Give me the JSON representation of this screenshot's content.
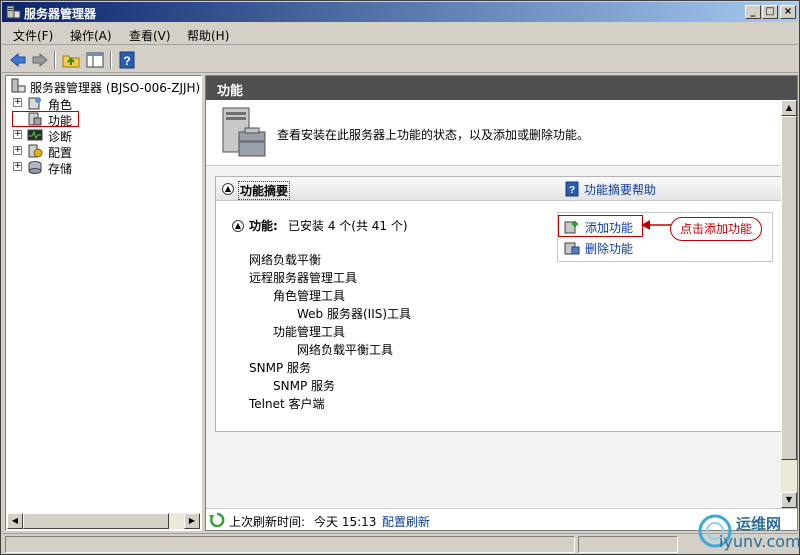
{
  "window": {
    "title": "服务器管理器",
    "minimize_label": "_",
    "restore_label": "□",
    "close_label": "×"
  },
  "menu": {
    "items": [
      {
        "label": "文件(F)"
      },
      {
        "label": "操作(A)"
      },
      {
        "label": "查看(V)"
      },
      {
        "label": "帮助(H)"
      }
    ]
  },
  "toolbar": {
    "icons": [
      "back-arrow-icon",
      "forward-arrow-icon",
      "up-folder-icon",
      "show-hide-tree-icon",
      "help-icon"
    ]
  },
  "tree": {
    "root_label": "服务器管理器 (BJSO-006-ZJJH)",
    "items": [
      {
        "label": "角色",
        "expander": "+",
        "icon": "roles-icon"
      },
      {
        "label": "功能",
        "expander": "",
        "icon": "features-icon",
        "selected": true
      },
      {
        "label": "诊断",
        "expander": "+",
        "icon": "diagnostics-icon"
      },
      {
        "label": "配置",
        "expander": "+",
        "icon": "configuration-icon"
      },
      {
        "label": "存储",
        "expander": "+",
        "icon": "storage-icon"
      }
    ]
  },
  "main": {
    "header": "功能",
    "banner_text": "查看安装在此服务器上功能的状态，以及添加或删除功能。",
    "summary_title": "功能摘要",
    "summary_help_link": "功能摘要帮助",
    "features_heading": "功能:",
    "features_count": "已安装 4 个(共 41 个)",
    "features": [
      {
        "label": "网络负载平衡",
        "level": 0
      },
      {
        "label": "远程服务器管理工具",
        "level": 0
      },
      {
        "label": "角色管理工具",
        "level": 1
      },
      {
        "label": "Web 服务器(IIS)工具",
        "level": 2
      },
      {
        "label": "功能管理工具",
        "level": 1
      },
      {
        "label": "网络负载平衡工具",
        "level": 2
      },
      {
        "label": "SNMP 服务",
        "level": 0
      },
      {
        "label": "SNMP 服务",
        "level": 1
      },
      {
        "label": "Telnet 客户端",
        "level": 0
      }
    ],
    "actions": {
      "add_label": "添加功能",
      "remove_label": "删除功能"
    },
    "annotation": "点击添加功能",
    "status": {
      "last_refresh_label": "上次刷新时间:",
      "last_refresh_value": "今天 15:13",
      "configure_refresh_link": "配置刷新"
    }
  },
  "watermark": {
    "line1": "运维网",
    "line2": "iyunv.com"
  },
  "colors": {
    "title_gradient_start": "#0a246a",
    "title_gradient_end": "#a6caf0",
    "header_bg": "#4f4f4f",
    "link": "#0b3c9c",
    "annotation_red": "#c00000"
  }
}
